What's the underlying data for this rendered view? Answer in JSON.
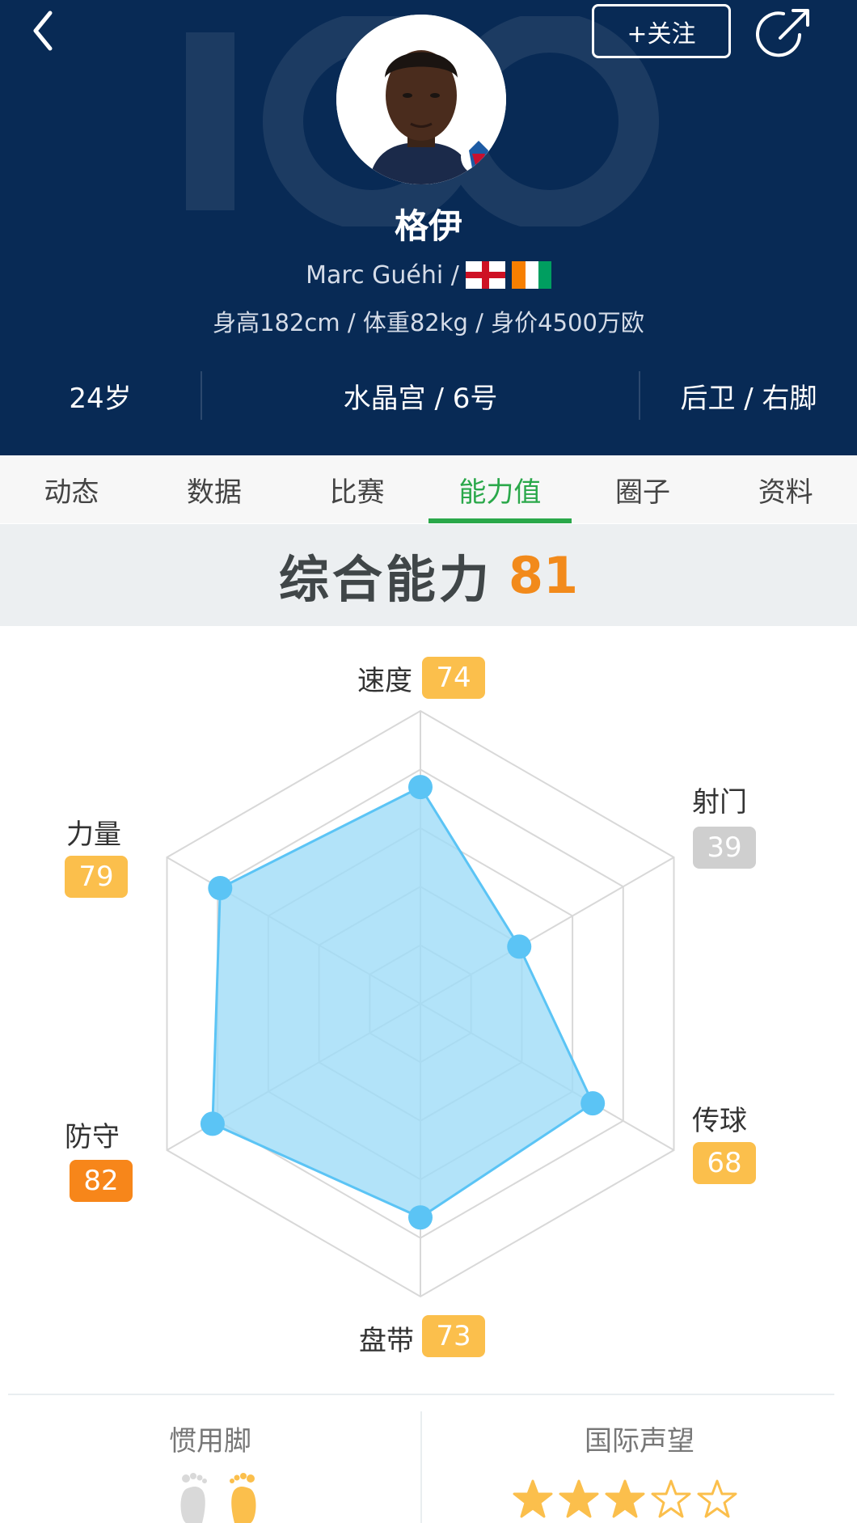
{
  "header": {
    "follow_label": "+关注",
    "back_icon": "chevron-left-icon",
    "share_icon": "share-icon",
    "player_name": "格伊",
    "english_name": "Marc Guéhi /",
    "flags": [
      "england-flag",
      "ireland-flag"
    ],
    "metrics": "身高182cm / 体重82kg / 身价4500万欧",
    "age": "24岁",
    "club_number": "水晶宫 / 6号",
    "position_foot": "后卫 / 右脚",
    "bg_color": "#082a55"
  },
  "tabs": [
    {
      "label": "动态",
      "active": false
    },
    {
      "label": "数据",
      "active": false
    },
    {
      "label": "比赛",
      "active": false
    },
    {
      "label": "能力值",
      "active": true
    },
    {
      "label": "圈子",
      "active": false
    },
    {
      "label": "资料",
      "active": false
    }
  ],
  "overall": {
    "label": "综合能力",
    "value": "81"
  },
  "chart_data": {
    "type": "radar",
    "axes": [
      "速度",
      "射门",
      "传球",
      "盘带",
      "防守",
      "力量"
    ],
    "values": [
      74,
      39,
      68,
      73,
      82,
      79
    ],
    "max": 100,
    "badge_colors": [
      "#fbbf4c",
      "#cfcfcf",
      "#fbbf4c",
      "#fbbf4c",
      "#f7861a",
      "#fbbf4c"
    ],
    "fill_color": "#9fdcf8",
    "stroke_color": "#5bc4f5"
  },
  "bottom": {
    "preferred_foot_label": "惯用脚",
    "reputation_label": "国际声望",
    "reputation_stars": 3,
    "reputation_max": 5
  }
}
